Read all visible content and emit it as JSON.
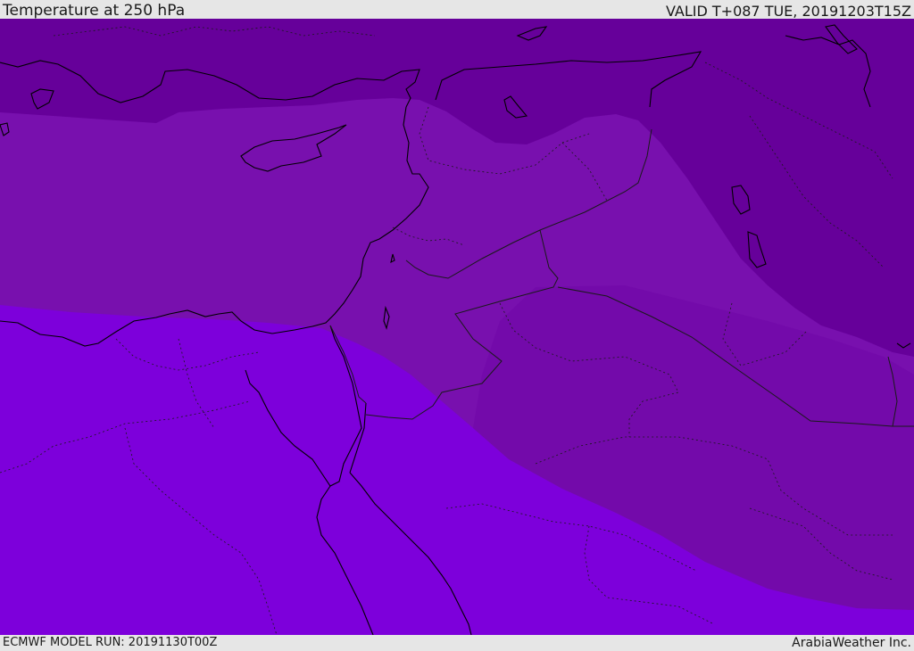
{
  "header": {
    "title": "Temperature at 250 hPa",
    "valid": "VALID T+087 TUE, 20191203T15Z"
  },
  "footer": {
    "model_run": "ECMWF MODEL RUN: 20191130T00Z",
    "brand": "ArabiaWeather Inc."
  },
  "colors": {
    "band_cold": "#66009a",
    "band_mid": "#7810ae",
    "band_east": "#730aaa",
    "band_warm": "#7d00db",
    "coastline": "#000000",
    "border": "#1a1a1a"
  }
}
